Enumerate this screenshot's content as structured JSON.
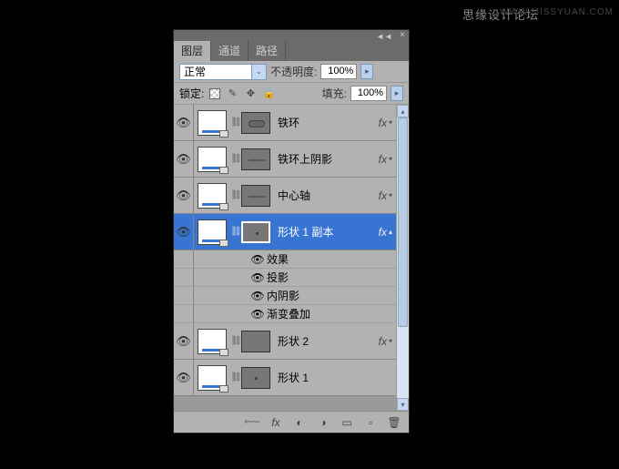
{
  "watermark": {
    "left": "思缘设计论坛",
    "right": "WWW.MISSYUAN.COM"
  },
  "tabs": {
    "layers": "图层",
    "channels": "通道",
    "paths": "路径"
  },
  "blend": {
    "mode": "正常",
    "opacity_label": "不透明度:",
    "opacity_value": "100%"
  },
  "lock": {
    "label": "锁定:",
    "fill_label": "填充:",
    "fill_value": "100%"
  },
  "layers": [
    {
      "name": "铁环",
      "fx": true
    },
    {
      "name": "铁环上阴影",
      "fx": true
    },
    {
      "name": "中心轴",
      "fx": true
    },
    {
      "name": "形状 1 副本",
      "fx": true,
      "selected": true
    },
    {
      "name": "形状 2",
      "fx": true
    },
    {
      "name": "形状 1"
    }
  ],
  "effects": {
    "header": "效果",
    "items": [
      "投影",
      "内阴影",
      "渐变叠加"
    ]
  },
  "footer_icons": [
    "link",
    "fx",
    "mask",
    "adjust",
    "group",
    "new",
    "trash"
  ]
}
